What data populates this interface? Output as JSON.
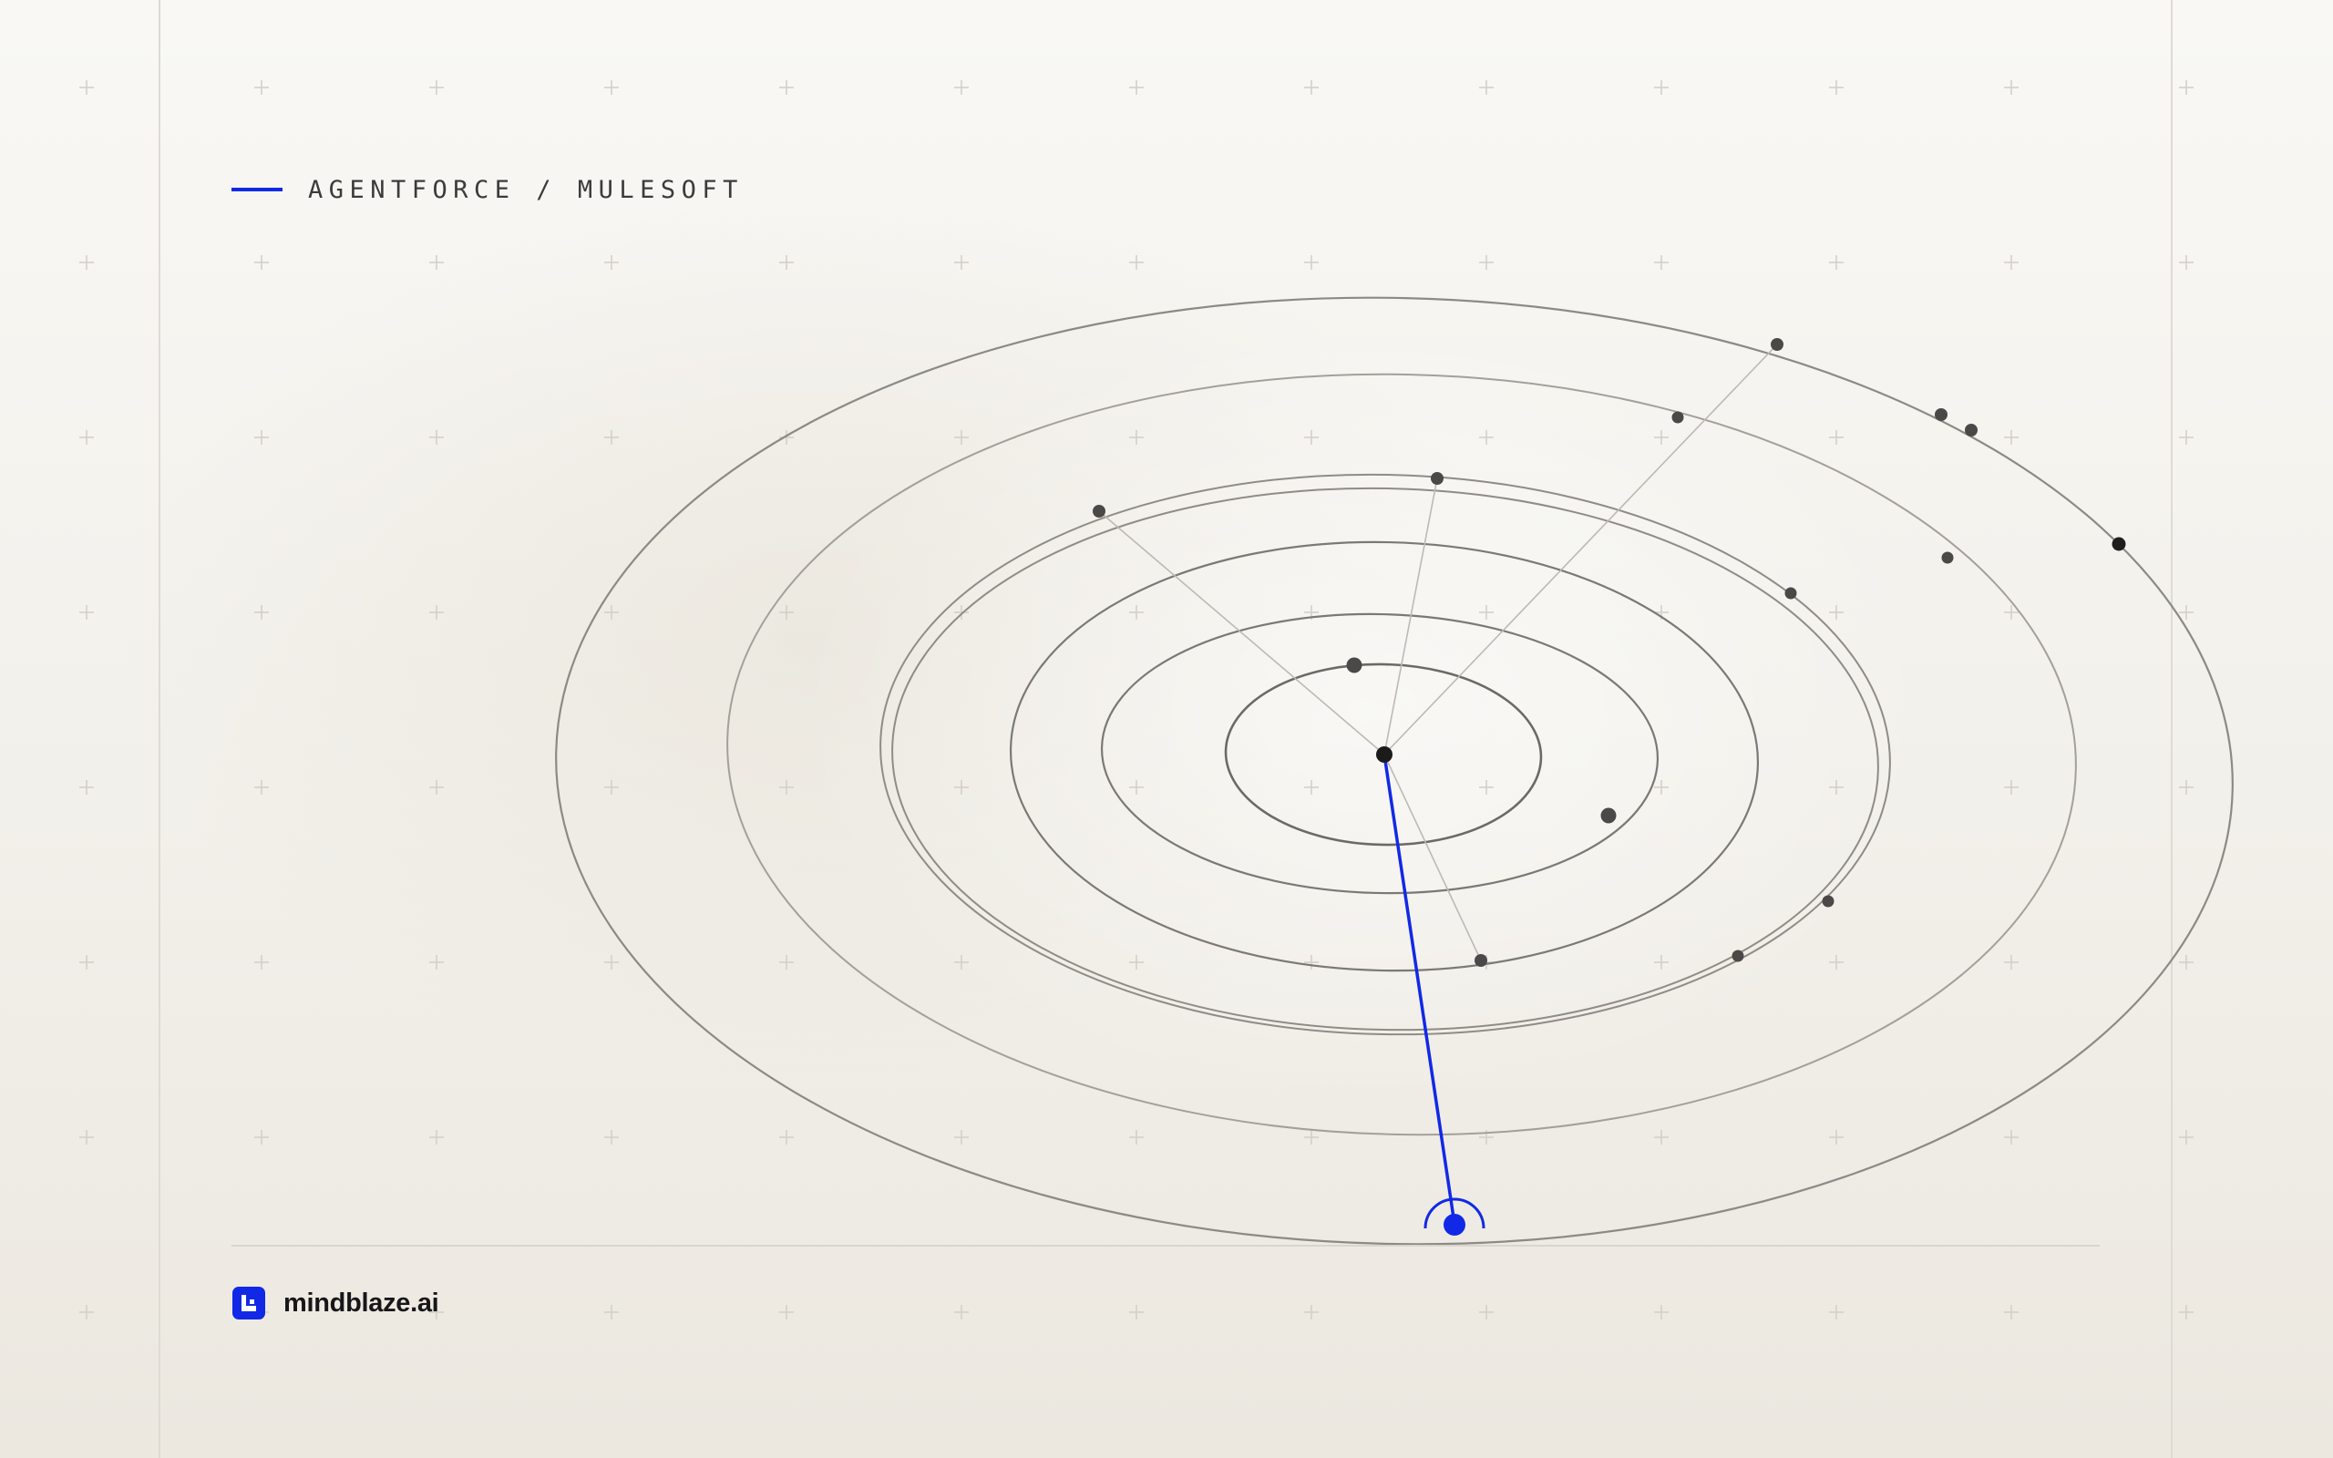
{
  "header": {
    "title": "AGENTFORCE / MULESOFT",
    "accent_color": "#1129e6"
  },
  "brand": {
    "name": "mindblaze.ai",
    "logo_icon": "mindblaze-logo-icon",
    "color": "#1129e6"
  },
  "diagram": {
    "type": "concentric-orbits",
    "orbit_count": 7,
    "node_count": 17,
    "highlight_color": "#1129e6",
    "line_color": "#8a8782"
  }
}
